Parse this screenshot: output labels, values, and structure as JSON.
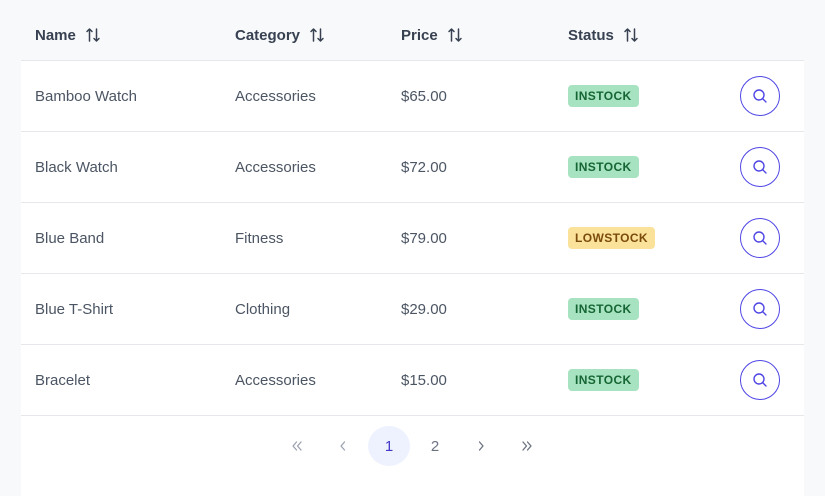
{
  "table": {
    "headers": {
      "name": "Name",
      "category": "Category",
      "price": "Price",
      "status": "Status"
    },
    "rows": [
      {
        "name": "Bamboo Watch",
        "category": "Accessories",
        "price": "$65.00",
        "status": "INSTOCK"
      },
      {
        "name": "Black Watch",
        "category": "Accessories",
        "price": "$72.00",
        "status": "INSTOCK"
      },
      {
        "name": "Blue Band",
        "category": "Fitness",
        "price": "$79.00",
        "status": "LOWSTOCK"
      },
      {
        "name": "Blue T-Shirt",
        "category": "Clothing",
        "price": "$29.00",
        "status": "INSTOCK"
      },
      {
        "name": "Bracelet",
        "category": "Accessories",
        "price": "$15.00",
        "status": "INSTOCK"
      }
    ]
  },
  "paginator": {
    "first_icon": "double-chevron-left-icon",
    "prev_icon": "chevron-left-icon",
    "pages": [
      "1",
      "2"
    ],
    "current_page": "1",
    "next_icon": "chevron-right-icon",
    "last_icon": "double-chevron-right-icon"
  },
  "colors": {
    "accent": "#4f46e5",
    "instock_bg": "#a7e3c0",
    "instock_text": "#166534",
    "lowstock_bg": "#fbe29b",
    "lowstock_text": "#7a4b0a"
  }
}
